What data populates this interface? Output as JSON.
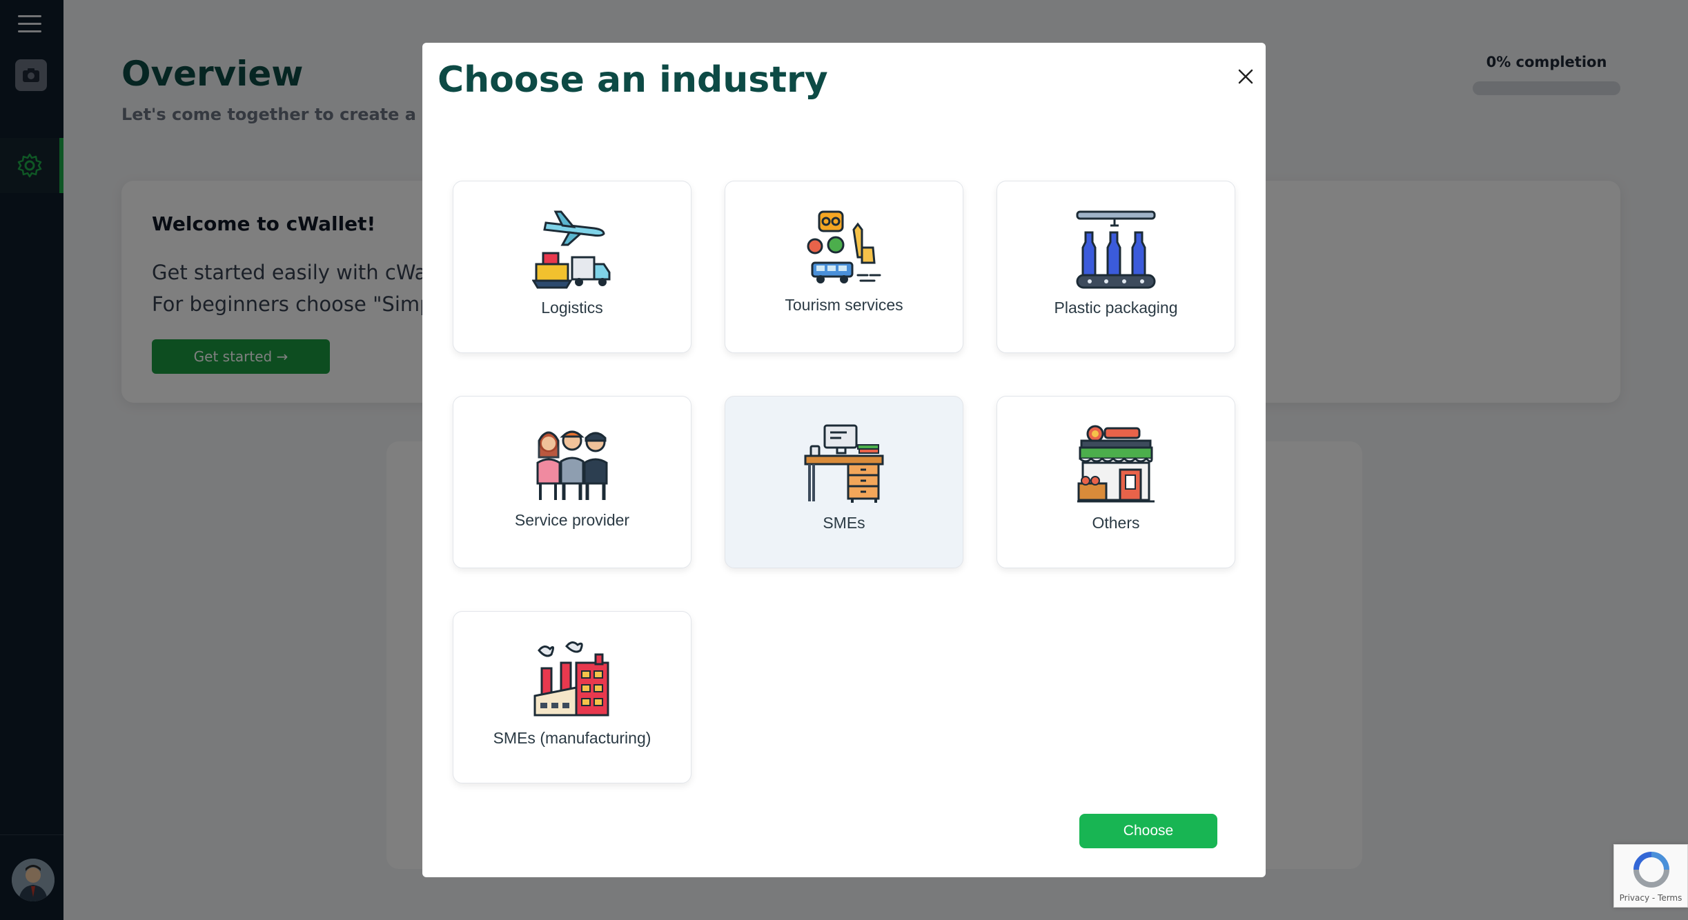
{
  "background": {
    "page_title": "Overview",
    "page_subtitle": "Let's come together to create a beau",
    "completion_label": "0% completion",
    "completion_value": 0,
    "welcome": {
      "title": "Welcome to cWallet!",
      "line1": "Get started easily with cWalle",
      "line2": "For beginners choose \"Simple",
      "button": "Get started →"
    }
  },
  "modal": {
    "title": "Choose an industry",
    "options": [
      {
        "label": "Logistics",
        "icon": "logistics-icon"
      },
      {
        "label": "Tourism services",
        "icon": "tourism-icon"
      },
      {
        "label": "Plastic packaging",
        "icon": "plastic-packaging-icon"
      },
      {
        "label": "Service provider",
        "icon": "service-provider-icon"
      },
      {
        "label": "SMEs",
        "icon": "sme-desk-icon",
        "selected": true
      },
      {
        "label": "Others",
        "icon": "store-icon"
      },
      {
        "label": "SMEs (manufacturing)",
        "icon": "factory-icon"
      }
    ],
    "choose_button": "Choose"
  },
  "recaptcha": {
    "links": "Privacy - Terms"
  },
  "colors": {
    "brand_green": "#18b553",
    "title_teal": "#0d4a45",
    "sidebar": "#0f1d2b"
  }
}
